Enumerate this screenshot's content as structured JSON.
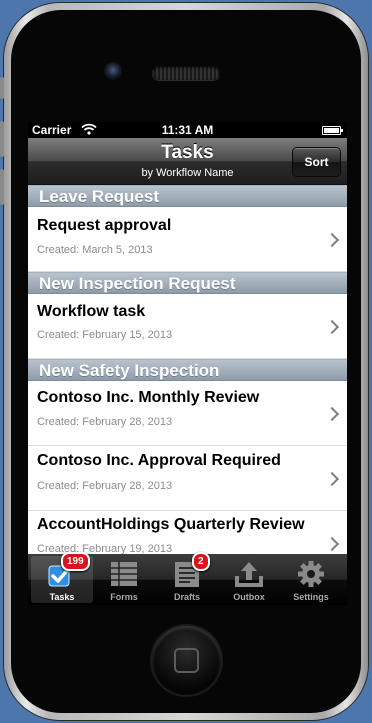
{
  "status_bar": {
    "carrier": "Carrier",
    "time": "11:31 AM"
  },
  "nav": {
    "title": "Tasks",
    "subtitle": "by Workflow Name",
    "sort_label": "Sort"
  },
  "sections": [
    {
      "header": "Leave Request",
      "items": [
        {
          "title": "Request approval",
          "created": "Created: March 5, 2013"
        }
      ]
    },
    {
      "header": "New Inspection Request",
      "items": [
        {
          "title": "Workflow task",
          "created": "Created: February 15, 2013"
        }
      ]
    },
    {
      "header": "New Safety Inspection",
      "items": [
        {
          "title": "Contoso Inc. Monthly Review",
          "created": "Created: February 28, 2013"
        },
        {
          "title": "Contoso Inc. Approval Required",
          "created": "Created: February 28, 2013"
        },
        {
          "title": "AccountHoldings Quarterly Review",
          "created": "Created: February 19, 2013"
        }
      ]
    }
  ],
  "tabs": [
    {
      "label": "Tasks",
      "icon": "tasks-checkbox-icon",
      "badge": "199",
      "selected": true
    },
    {
      "label": "Forms",
      "icon": "forms-table-icon"
    },
    {
      "label": "Drafts",
      "icon": "drafts-document-icon",
      "badge": "2"
    },
    {
      "label": "Outbox",
      "icon": "outbox-upload-icon"
    },
    {
      "label": "Settings",
      "icon": "settings-gear-icon"
    }
  ],
  "colors": {
    "background": "#4d76ad",
    "badge": "#d8141c",
    "section_header": "#9aa7b3",
    "tasks_icon_blue": "#2f8fe0"
  }
}
